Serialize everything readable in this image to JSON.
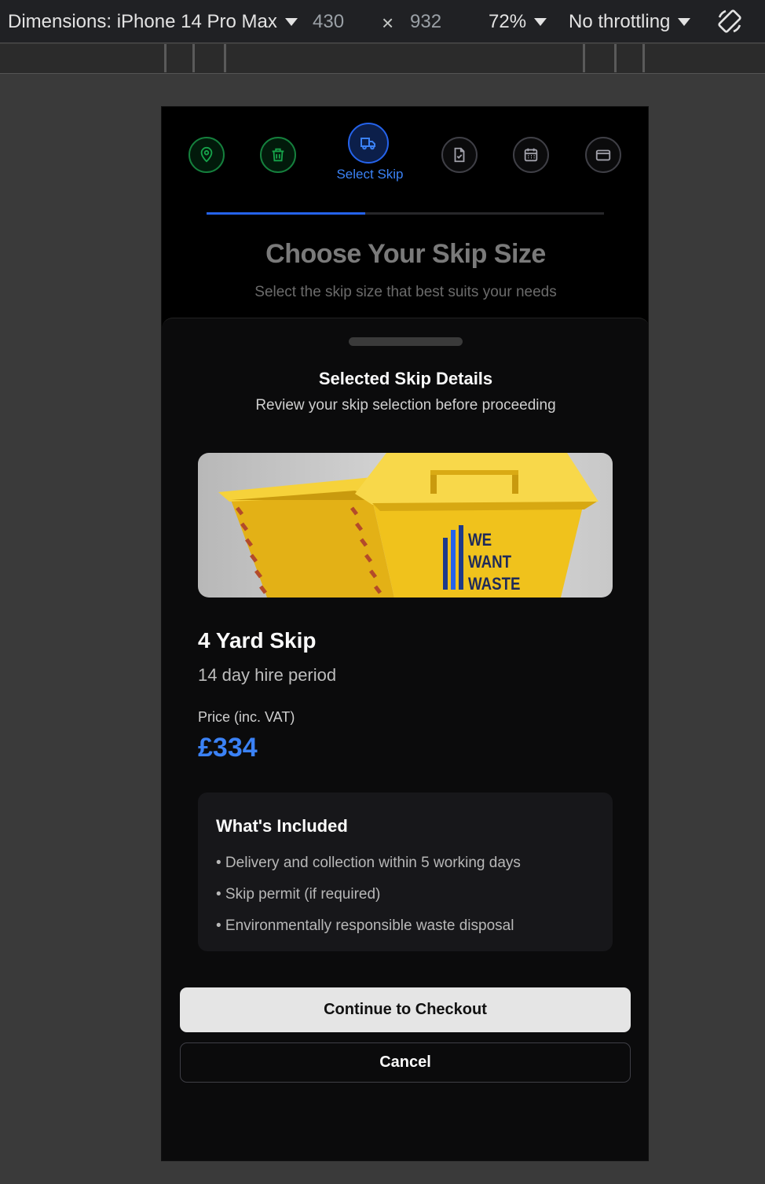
{
  "devtools": {
    "dimensions_label": "Dimensions: iPhone 14 Pro Max",
    "width": "430",
    "times": "×",
    "height": "932",
    "zoom": "72%",
    "throttling": "No throttling",
    "rotate_icon": "rotate-icon"
  },
  "stepper": {
    "steps": [
      {
        "icon": "map-pin-icon",
        "state": "done"
      },
      {
        "icon": "trash-icon",
        "state": "done"
      },
      {
        "icon": "truck-icon",
        "state": "active",
        "label": "Select Skip"
      },
      {
        "icon": "file-check-icon",
        "state": "todo"
      },
      {
        "icon": "calendar-icon",
        "state": "todo"
      },
      {
        "icon": "credit-card-icon",
        "state": "todo"
      }
    ],
    "progress": 0.4
  },
  "hero": {
    "title": "Choose Your Skip Size",
    "subtitle": "Select the skip size that best suits your needs"
  },
  "sheet": {
    "title": "Selected Skip Details",
    "subtitle": "Review your skip selection before proceeding",
    "image_logo_text": [
      "WE",
      "WANT",
      "WASTE"
    ],
    "skip_name": "4 Yard Skip",
    "hire_period": "14 day hire period",
    "price_label": "Price (inc. VAT)",
    "price": "£334",
    "included": {
      "title": "What's Included",
      "items": [
        "• Delivery and collection within 5 working days",
        "• Skip permit (if required)",
        "• Environmentally responsible waste disposal"
      ]
    },
    "continue_label": "Continue to Checkout",
    "cancel_label": "Cancel"
  },
  "colors": {
    "accent_blue": "#3b82f6",
    "done_green": "#15803d",
    "skip_yellow": "#f2c21a"
  }
}
